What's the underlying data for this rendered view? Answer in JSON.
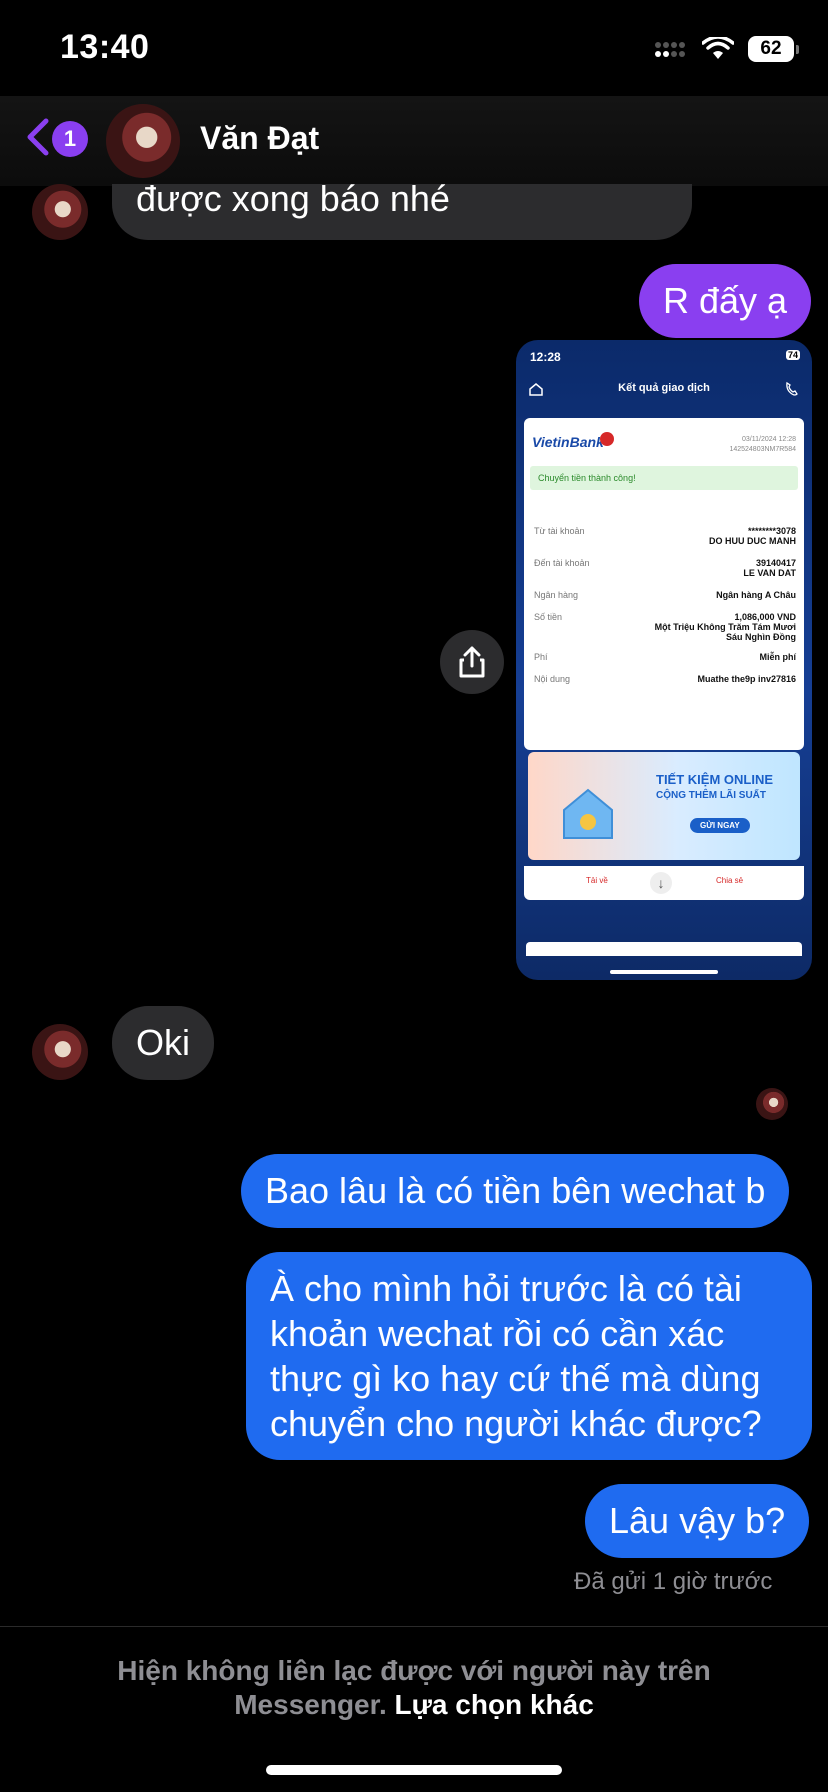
{
  "status_bar": {
    "time": "13:40",
    "battery": "62"
  },
  "header": {
    "back_badge": "1",
    "contact_name": "Văn Đạt"
  },
  "messages": {
    "m1": "được xong báo nhé",
    "m2": "R đấy ạ",
    "m3": "Oki",
    "m4": "Bao lâu là có tiền bên wechat b",
    "m5": "À cho mình hỏi trước là có tài khoản wechat rồi có cần xác thực gì ko hay cứ thế mà dùng chuyển cho người khác được?",
    "m6": "Lâu vậy b?"
  },
  "screenshot": {
    "time": "12:28",
    "battery": "74",
    "title": "Kết quả giao dịch",
    "bank": "VietinBank",
    "date": "03/11/2024 12:28",
    "ref": "142524803NM7R584",
    "success": "Chuyển tiền thành công!",
    "rows": {
      "from_label": "Từ tài khoản",
      "from_value": "********3078",
      "from_name": "DO HUU DUC MANH",
      "to_label": "Đến tài khoản",
      "to_value": "39140417",
      "to_name": "LE VAN DAT",
      "bank_label": "Ngân hàng",
      "bank_value": "Ngân hàng A Châu",
      "amount_label": "Số tiền",
      "amount_value": "1,086,000 VND",
      "amount_words": "Một Triệu Không Trăm Tám Mươi Sáu Nghìn Đồng",
      "fee_label": "Phí",
      "fee_value": "Miễn phí",
      "content_label": "Nội dung",
      "content_value": "Muathe the9p inv27816"
    },
    "promo_title": "TIẾT KIỆM ONLINE",
    "promo_sub": "CỘNG THÊM LÃI SUẤT",
    "promo_btn": "GỬI NGAY",
    "download": "Tải về",
    "share": "Chia sẻ"
  },
  "status": {
    "sent": "Đã gửi 1 giờ trước"
  },
  "footer": {
    "line1": "Hiện không liên lạc được với người này trên",
    "line2": "Messenger.",
    "link": "Lựa chọn khác"
  },
  "colors": {
    "purple": "#8a3ff0",
    "blue": "#1f6bf0",
    "incoming": "#2c2c2e"
  }
}
